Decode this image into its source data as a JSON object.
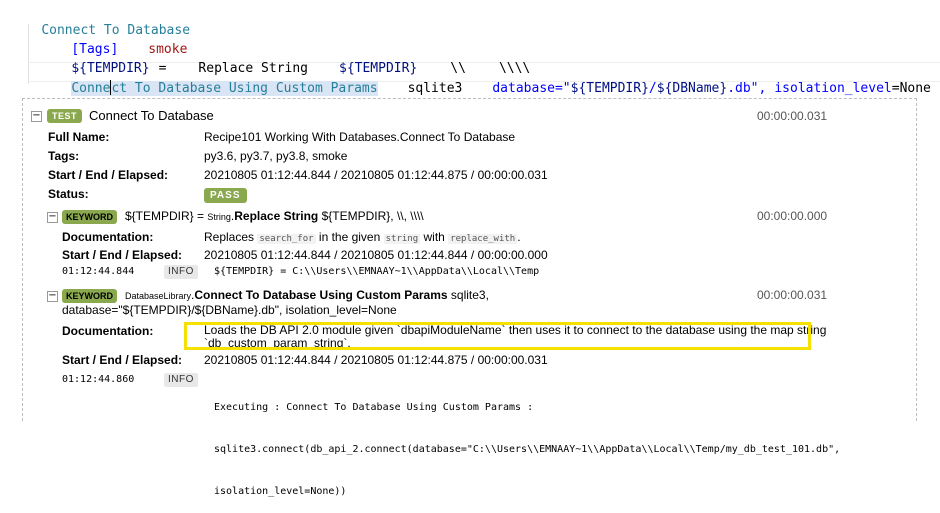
{
  "editor": {
    "test_name": "Connect To Database",
    "tags_setting": "[Tags]",
    "tags_value": "smoke",
    "var_tempdir": "${TEMPDIR}",
    "equals": "=",
    "replace_kw": "Replace String",
    "replace_arg1": "${TEMPDIR}",
    "replace_arg2": "\\\\",
    "replace_arg3": "\\\\\\\\",
    "connect_kw_before_caret": "Conne",
    "connect_kw_after_caret": "ct To Database Using Custom Params",
    "connect_arg1": "sqlite3",
    "connect_arg2_prefix": "database=\"",
    "connect_arg2_var1": "${TEMPDIR}",
    "connect_arg2_sep": "/",
    "connect_arg2_var2": "${DBName}",
    "connect_arg2_suffix": ".db\",",
    "connect_arg3_name": "isolation_level",
    "connect_arg3_eq": "=",
    "connect_arg3_value": "None"
  },
  "log": {
    "test": {
      "toggle": "−",
      "badge": "TEST",
      "name": "Connect To Database",
      "elapsed": "00:00:00.031",
      "full_name_label": "Full Name:",
      "full_name": "Recipe101 Working With Databases.Connect To Database",
      "tags_label": "Tags:",
      "tags": "py3.6, py3.7, py3.8, smoke",
      "sel_label": "Start / End / Elapsed:",
      "sel": "20210805 01:12:44.844 / 20210805 01:12:44.875 / 00:00:00.031",
      "status_label": "Status:",
      "status": "PASS"
    },
    "kw1": {
      "toggle": "−",
      "badge": "KEYWORD",
      "assign": "${TEMPDIR} =",
      "library": "String",
      "dot": ".",
      "name": "Replace String",
      "args": "${TEMPDIR}, \\\\, \\\\\\\\",
      "elapsed": "00:00:00.000",
      "doc_label": "Documentation:",
      "doc_1": "Replaces",
      "doc_code1": "search_for",
      "doc_2": "in the given",
      "doc_code2": "string",
      "doc_3": "with",
      "doc_code3": "replace_with",
      "doc_4": ".",
      "sel_label": "Start / End / Elapsed:",
      "sel": "20210805 01:12:44.844 / 20210805 01:12:44.844 / 00:00:00.000",
      "msg_time": "01:12:44.844",
      "msg_level": "INFO",
      "msg": "${TEMPDIR} = C:\\\\Users\\\\EMNAAY~1\\\\AppData\\\\Local\\\\Temp"
    },
    "kw2": {
      "toggle": "−",
      "badge": "KEYWORD",
      "library": "DatabaseLibrary",
      "dot": ".",
      "name": "Connect To Database Using Custom Params",
      "args_line1": "sqlite3,",
      "args_line2": "database=\"${TEMPDIR}/${DBName}.db\", isolation_level=None",
      "elapsed": "00:00:00.031",
      "doc_label": "Documentation:",
      "doc_line1": "Loads the DB API 2.0 module given `dbapiModuleName` then uses it to connect to the database using the map string",
      "doc_line2": "`db_custom_param_string`.",
      "sel_label": "Start / End / Elapsed:",
      "sel": "20210805 01:12:44.844 / 20210805 01:12:44.875 / 00:00:00.031",
      "msg_time": "01:12:44.860",
      "msg_level": "INFO",
      "msg_line1": "Executing : Connect To Database Using Custom Params :",
      "msg_line2": "sqlite3.connect(db_api_2.connect(database=\"C:\\\\Users\\\\EMNAAY~1\\\\AppData\\\\Local\\\\Temp/my_db_test_101.db\",",
      "msg_line3": "isolation_level=None))"
    }
  },
  "colors": {
    "badge_green": "#8aa84e",
    "highlight_yellow": "#f5e100",
    "test_name_teal": "#267f99",
    "variable_navy": "#001080",
    "string_red": "#a31515"
  }
}
